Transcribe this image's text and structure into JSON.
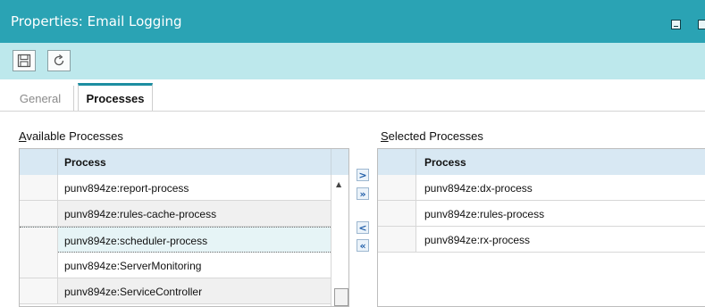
{
  "window": {
    "title": "Properties: Email Logging",
    "min_icon": "minimize-icon",
    "max_icon": "restore-icon"
  },
  "toolbar": {
    "save_icon": "save-icon",
    "refresh_icon": "refresh-icon"
  },
  "tabs": [
    {
      "label": "General",
      "active": false
    },
    {
      "label": "Processes",
      "active": true
    }
  ],
  "available": {
    "label": "Available Processes",
    "column": "Process",
    "rows": [
      "punv894ze:report-process",
      "punv894ze:rules-cache-process",
      "punv894ze:scheduler-process",
      "punv894ze:ServerMonitoring",
      "punv894ze:ServiceController"
    ],
    "selected_index": 2
  },
  "selected": {
    "label": "Selected Processes",
    "column": "Process",
    "rows": [
      "punv894ze:dx-process",
      "punv894ze:rules-process",
      "punv894ze:rx-process"
    ]
  },
  "move_buttons": {
    "add": ">",
    "add_all": "»",
    "remove": "<",
    "remove_all": "«"
  },
  "colors": {
    "titlebar": "#2aa3b4",
    "toolbar": "#bde8ec",
    "grid_header": "#d8e8f3",
    "selected_row": "#e6f4f6",
    "tab_accent": "#1d8ea1"
  }
}
